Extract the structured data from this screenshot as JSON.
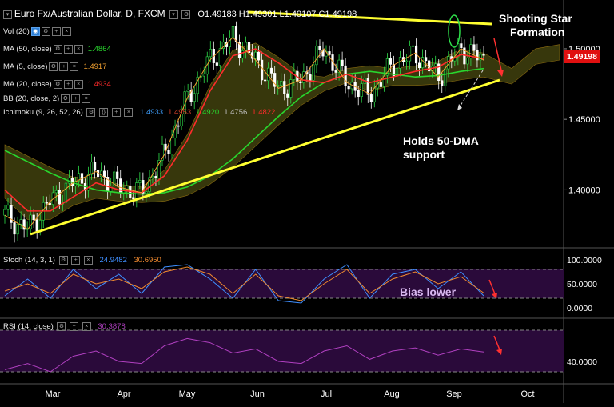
{
  "header": {
    "symbol": "Euro Fx/Australian Dollar, D, FXCM",
    "ohlc": "O1.49183  H1.49301  L1.49107  C1.49198"
  },
  "indicators": [
    {
      "label": "Vol (20)",
      "value": "",
      "color": "#ffffff"
    },
    {
      "label": "MA (50, close)",
      "value": "1.4864",
      "color": "#29d62e"
    },
    {
      "label": "MA (5, close)",
      "value": "1.4917",
      "color": "#f0a030"
    },
    {
      "label": "MA (20, close)",
      "value": "1.4934",
      "color": "#ff2b2b"
    },
    {
      "label": "BB (20, close, 2)",
      "value": "",
      "color": "#ffffff"
    }
  ],
  "ichimoku": {
    "label": "Ichimoku (9, 26, 52, 26)",
    "values": [
      {
        "v": "1.4933",
        "color": "#3fa0ff"
      },
      {
        "v": "1.4953",
        "color": "#d0402a"
      },
      {
        "v": "1.4920",
        "color": "#29d62e"
      },
      {
        "v": "1.4756",
        "color": "#c0c0c0"
      },
      {
        "v": "1.4822",
        "color": "#ff2b2b"
      }
    ]
  },
  "stoch": {
    "label": "Stoch (14, 3, 1)",
    "k": "24.9482",
    "d": "30.6950",
    "k_color": "#3f8fff",
    "d_color": "#f08a30"
  },
  "rsi": {
    "label": "RSI (14, close)",
    "value": "30.3878",
    "color": "#b040c0"
  },
  "annotations": {
    "shooting_star_1": "Shooting Star",
    "shooting_star_2": "Formation",
    "holds_1": "Holds 50-DMA",
    "holds_2": "support",
    "bias": "Bias lower"
  },
  "last_price": "1.49198",
  "chart_data": [
    {
      "type": "line",
      "panel": "price",
      "y_ticks": [
        "1.50000",
        "1.45000",
        "1.40000"
      ],
      "y_tick_values": [
        1.5,
        1.45,
        1.4
      ],
      "x_ticks": [
        "Mar",
        "Apr",
        "May",
        "Jun",
        "Jul",
        "Aug",
        "Sep",
        "Oct"
      ],
      "ylim": [
        1.36,
        1.53
      ],
      "series": [
        {
          "name": "MA (50, close)",
          "color": "#29d62e",
          "values": [
            1.428,
            1.42,
            1.412,
            1.405,
            1.4,
            1.398,
            1.397,
            1.398,
            1.402,
            1.41,
            1.422,
            1.437,
            1.452,
            1.466,
            1.476,
            1.482,
            1.484,
            1.482,
            1.48,
            1.481,
            1.484,
            1.486
          ]
        },
        {
          "name": "MA (20, close)",
          "color": "#ff2b2b",
          "values": [
            1.4,
            1.385,
            1.385,
            1.395,
            1.405,
            1.4,
            1.398,
            1.41,
            1.435,
            1.47,
            1.495,
            1.5,
            1.49,
            1.478,
            1.476,
            1.482,
            1.476,
            1.48,
            1.484,
            1.487,
            1.496,
            1.493
          ]
        },
        {
          "name": "MA (5, close)",
          "color": "#f0a030",
          "values": [
            1.382,
            1.372,
            1.392,
            1.405,
            1.413,
            1.402,
            1.398,
            1.425,
            1.465,
            1.492,
            1.508,
            1.492,
            1.472,
            1.478,
            1.5,
            1.476,
            1.468,
            1.488,
            1.497,
            1.48,
            1.5,
            1.492
          ]
        }
      ]
    },
    {
      "type": "line",
      "panel": "stoch",
      "y_ticks": [
        "100.0000",
        "50.0000",
        "0.0000"
      ],
      "ylim": [
        0,
        100
      ],
      "series": [
        {
          "name": "%K",
          "color": "#3f8fff",
          "values": [
            25,
            60,
            20,
            80,
            40,
            70,
            30,
            85,
            90,
            60,
            20,
            80,
            15,
            10,
            60,
            90,
            20,
            70,
            80,
            40,
            75,
            25
          ]
        },
        {
          "name": "%D",
          "color": "#f08a30",
          "values": [
            35,
            50,
            30,
            70,
            50,
            60,
            40,
            75,
            85,
            70,
            30,
            70,
            25,
            15,
            50,
            80,
            30,
            60,
            75,
            50,
            65,
            31
          ]
        }
      ]
    },
    {
      "type": "line",
      "panel": "rsi",
      "y_ticks": [
        "40.0000"
      ],
      "ylim": [
        20,
        80
      ],
      "series": [
        {
          "name": "RSI (14, close)",
          "color": "#b040c0",
          "values": [
            32,
            38,
            30,
            45,
            50,
            40,
            38,
            55,
            62,
            58,
            48,
            52,
            40,
            38,
            50,
            55,
            42,
            50,
            53,
            46,
            52,
            49
          ]
        }
      ]
    }
  ]
}
